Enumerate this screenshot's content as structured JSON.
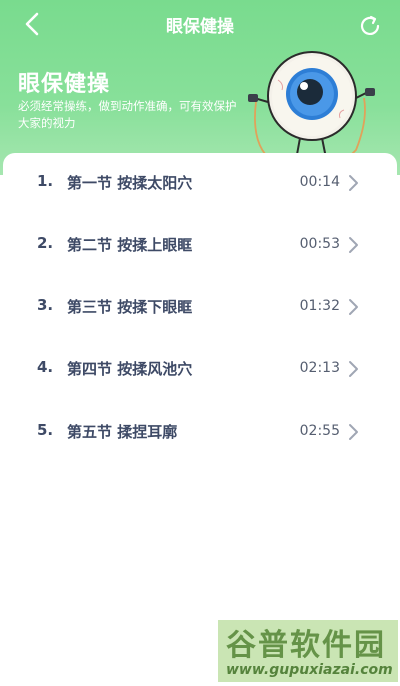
{
  "nav": {
    "title": "眼保健操"
  },
  "hero": {
    "title": "眼保健操",
    "description": "必须经常操练，做到动作准确，可有效保护大家的视力"
  },
  "exercises": [
    {
      "number": "1.",
      "title": "第一节 按揉太阳穴",
      "duration": "00:14"
    },
    {
      "number": "2.",
      "title": "第二节 按揉上眼眶",
      "duration": "00:53"
    },
    {
      "number": "3.",
      "title": "第三节 按揉下眼眶",
      "duration": "01:32"
    },
    {
      "number": "4.",
      "title": "第四节 按揉风池穴",
      "duration": "02:13"
    },
    {
      "number": "5.",
      "title": "第五节 揉捏耳廓",
      "duration": "02:55"
    }
  ],
  "watermark": {
    "brand": "谷普软件园",
    "url": "www.gupuxiazai.com"
  },
  "colors": {
    "header_green": "#7fdc92",
    "text_primary": "#3e4a66",
    "chevron": "#a0a6b4"
  },
  "icons": {
    "back": "back-arrow-icon",
    "refresh": "refresh-icon",
    "chevron": "chevron-right-icon",
    "mascot": "eyeball-mascot-icon"
  }
}
